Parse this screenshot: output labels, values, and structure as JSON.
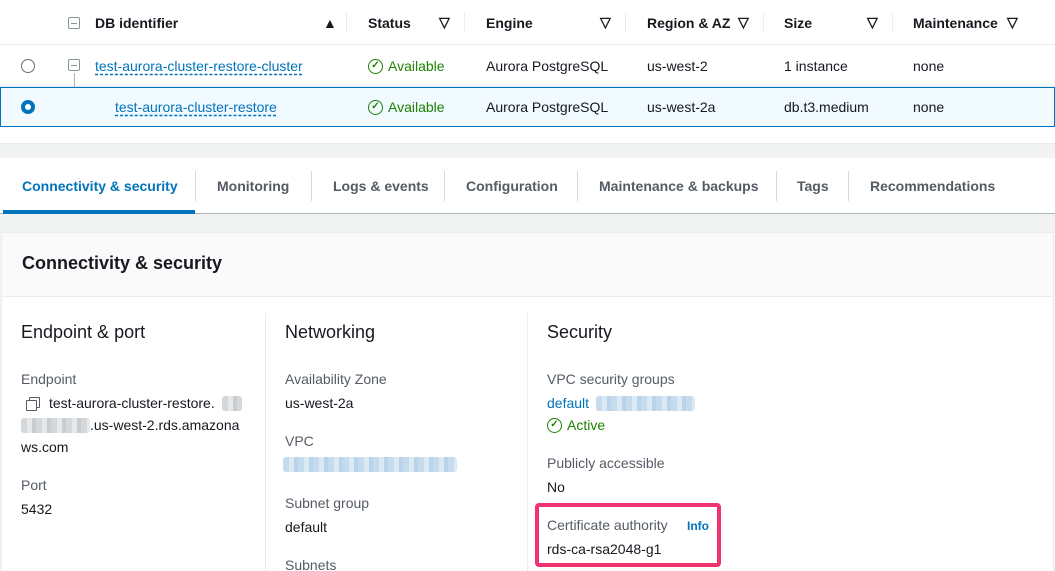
{
  "table": {
    "columns": [
      {
        "label": "DB identifier"
      },
      {
        "label": "Status"
      },
      {
        "label": "Engine"
      },
      {
        "label": "Region & AZ"
      },
      {
        "label": "Size"
      },
      {
        "label": "Maintenance"
      }
    ],
    "rows": [
      {
        "db_identifier": "test-aurora-cluster-restore-cluster",
        "status": "Available",
        "engine": "Aurora PostgreSQL",
        "region_az": "us-west-2",
        "size": "1 instance",
        "maintenance": "none",
        "selected": false
      },
      {
        "db_identifier": "test-aurora-cluster-restore",
        "status": "Available",
        "engine": "Aurora PostgreSQL",
        "region_az": "us-west-2a",
        "size": "db.t3.medium",
        "maintenance": "none",
        "selected": true
      }
    ]
  },
  "tabs": [
    {
      "label": "Connectivity & security",
      "active": true
    },
    {
      "label": "Monitoring"
    },
    {
      "label": "Logs & events"
    },
    {
      "label": "Configuration"
    },
    {
      "label": "Maintenance & backups"
    },
    {
      "label": "Tags"
    },
    {
      "label": "Recommendations"
    }
  ],
  "panel": {
    "title": "Connectivity & security",
    "endpoint_port": {
      "title": "Endpoint & port",
      "endpoint_label": "Endpoint",
      "endpoint_line1": "test-aurora-cluster-restore.",
      "endpoint_line2": ".us-west-2.rds.amazona",
      "endpoint_line3": "ws.com",
      "port_label": "Port",
      "port_value": "5432"
    },
    "networking": {
      "title": "Networking",
      "az_label": "Availability Zone",
      "az_value": "us-west-2a",
      "vpc_label": "VPC",
      "subnet_group_label": "Subnet group",
      "subnet_group_value": "default",
      "subnets_label": "Subnets"
    },
    "security": {
      "title": "Security",
      "vpc_sg_label": "VPC security groups",
      "vpc_sg_value": "default",
      "vpc_sg_status": "Active",
      "public_label": "Publicly accessible",
      "public_value": "No",
      "ca_label": "Certificate authority",
      "ca_info": "Info",
      "ca_value": "rds-ca-rsa2048-g1"
    }
  },
  "colors": {
    "accent": "#0073bb",
    "success": "#1d8102",
    "highlight": "#f0326e"
  }
}
